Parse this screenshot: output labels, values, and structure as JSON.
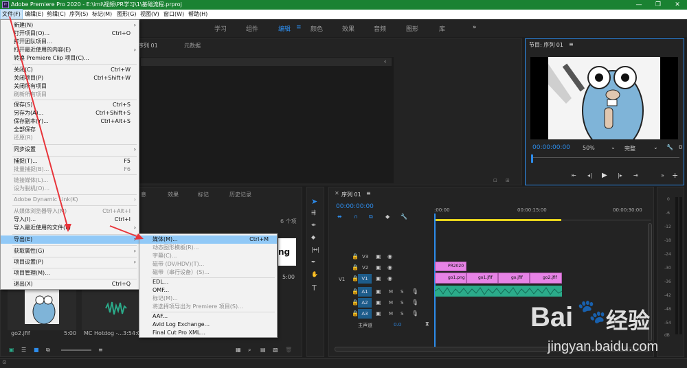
{
  "window": {
    "title": "Adobe Premiere Pro 2020 - E:\\imi\\视频\\PR学习\\1\\基础流程.prproj",
    "app_icon": "Pr",
    "minimize": "—",
    "maximize": "❐",
    "close": "✕"
  },
  "menubar": [
    "文件(F)",
    "编辑(E)",
    "剪辑(C)",
    "序列(S)",
    "标记(M)",
    "图形(G)",
    "视图(V)",
    "窗口(W)",
    "帮助(H)"
  ],
  "workspaces": [
    "学习",
    "组件",
    "编辑",
    "颜色",
    "效果",
    "音频",
    "图形",
    "库"
  ],
  "workspace_more": "»",
  "source_panel": {
    "tab1": "序列 01",
    "tab2": "元数据"
  },
  "program_monitor": {
    "title": "节目: 序列 01",
    "timecode": "00:00:00:00",
    "zoom": "50%",
    "quality": "完整"
  },
  "project_panel": {
    "tabs": [
      "息",
      "效果",
      "标记",
      "历史记录"
    ],
    "item_count": "6 个项",
    "partial_text": "ng",
    "duration1": "5:00",
    "items": [
      {
        "name": "go2.jfif",
        "duration": "5:00"
      },
      {
        "name": "MC Hotdog -...",
        "duration": "3:54:02"
      }
    ]
  },
  "timeline": {
    "title": "序列 01",
    "timecode": "00:00:00:00",
    "ruler": [
      ":00:00",
      "00:00:15:00",
      "00:00:30:00"
    ],
    "video_tracks": [
      {
        "name": "V3",
        "src": ""
      },
      {
        "name": "V2",
        "src": ""
      },
      {
        "name": "V1",
        "src": "V1"
      }
    ],
    "audio_tracks": [
      {
        "name": "A1"
      },
      {
        "name": "A2"
      },
      {
        "name": "A3"
      }
    ],
    "master": {
      "label": "主声道",
      "value": "0.0"
    },
    "clips_v2": [
      "PR2020"
    ],
    "clips_v1": [
      "go1.png",
      "go1.jfif",
      "go.jfif",
      "go2.jfif"
    ],
    "mute": "M",
    "solo": "S"
  },
  "meter_scale": [
    "0",
    "-6",
    "-12",
    "-18",
    "-24",
    "-30",
    "-36",
    "-42",
    "-48",
    "-54",
    "dB"
  ],
  "file_menu": [
    {
      "label": "新建(N)",
      "sc": "",
      "arrow": true,
      "dis": false
    },
    {
      "label": "打开项目(O)...",
      "sc": "Ctrl+O",
      "dis": false
    },
    {
      "label": "打开团队项目...",
      "sc": "",
      "dis": false
    },
    {
      "label": "打开最近使用的内容(E)",
      "sc": "",
      "arrow": true,
      "dis": false
    },
    {
      "label": "转换 Premiere Clip 项目(C)...",
      "sc": "",
      "dis": false,
      "sep": true
    },
    {
      "label": "关闭(C)",
      "sc": "Ctrl+W",
      "dis": false
    },
    {
      "label": "关闭项目(P)",
      "sc": "Ctrl+Shift+W",
      "dis": false
    },
    {
      "label": "关闭所有项目",
      "sc": "",
      "dis": false
    },
    {
      "label": "刷新所有项目",
      "sc": "",
      "dis": true,
      "sep": true
    },
    {
      "label": "保存(S)",
      "sc": "Ctrl+S",
      "dis": false
    },
    {
      "label": "另存为(A)...",
      "sc": "Ctrl+Shift+S",
      "dis": false
    },
    {
      "label": "保存副本(Y)...",
      "sc": "Ctrl+Alt+S",
      "dis": false
    },
    {
      "label": "全部保存",
      "sc": "",
      "dis": false
    },
    {
      "label": "还原(R)",
      "sc": "",
      "dis": true,
      "sep": true
    },
    {
      "label": "同步设置",
      "sc": "",
      "arrow": true,
      "dis": false,
      "sep": true
    },
    {
      "label": "捕捉(T)...",
      "sc": "F5",
      "dis": false
    },
    {
      "label": "批量捕捉(B)...",
      "sc": "F6",
      "dis": true,
      "sep": true
    },
    {
      "label": "链接媒体(L)...",
      "sc": "",
      "dis": true
    },
    {
      "label": "设为脱机(O)...",
      "sc": "",
      "dis": true,
      "sep": true
    },
    {
      "label": "Adobe Dynamic Link(K)",
      "sc": "",
      "arrow": true,
      "dis": true,
      "sep": true
    },
    {
      "label": "从媒体浏览器导入(M)",
      "sc": "Ctrl+Alt+I",
      "dis": true
    },
    {
      "label": "导入(I)...",
      "sc": "Ctrl+I",
      "dis": false
    },
    {
      "label": "导入最近使用的文件(F)",
      "sc": "",
      "arrow": true,
      "dis": false,
      "sep": true
    },
    {
      "label": "导出(E)",
      "sc": "",
      "arrow": true,
      "dis": false,
      "hl": true,
      "sep": true
    },
    {
      "label": "获取属性(G)",
      "sc": "",
      "arrow": true,
      "dis": false,
      "sep": true
    },
    {
      "label": "项目设置(P)",
      "sc": "",
      "arrow": true,
      "dis": false,
      "sep": true
    },
    {
      "label": "项目管理(M)...",
      "sc": "",
      "dis": false,
      "sep": true
    },
    {
      "label": "退出(X)",
      "sc": "Ctrl+Q",
      "dis": false
    }
  ],
  "export_menu": [
    {
      "label": "媒体(M)...",
      "sc": "Ctrl+M",
      "dis": false,
      "hl": true
    },
    {
      "label": "动态图形模板(R)...",
      "sc": "",
      "dis": true
    },
    {
      "label": "字幕(C)...",
      "sc": "",
      "dis": true
    },
    {
      "label": "磁带 (DV/HDV)(T)...",
      "sc": "",
      "dis": true
    },
    {
      "label": "磁带（串行设备）(S)...",
      "sc": "",
      "dis": true,
      "sep": true
    },
    {
      "label": "EDL...",
      "sc": "",
      "dis": false
    },
    {
      "label": "OMF...",
      "sc": "",
      "dis": false
    },
    {
      "label": "标记(M)...",
      "sc": "",
      "dis": true
    },
    {
      "label": "将选择项导出为 Premiere 项目(S)...",
      "sc": "",
      "dis": true,
      "sep": true
    },
    {
      "label": "AAF...",
      "sc": "",
      "dis": false
    },
    {
      "label": "Avid Log Exchange...",
      "sc": "",
      "dis": false
    },
    {
      "label": "Final Cut Pro XML...",
      "sc": "",
      "dis": false
    }
  ],
  "watermark": {
    "brand": "Bai",
    "brand2": "经验",
    "url": "jingyan.baidu.com"
  }
}
